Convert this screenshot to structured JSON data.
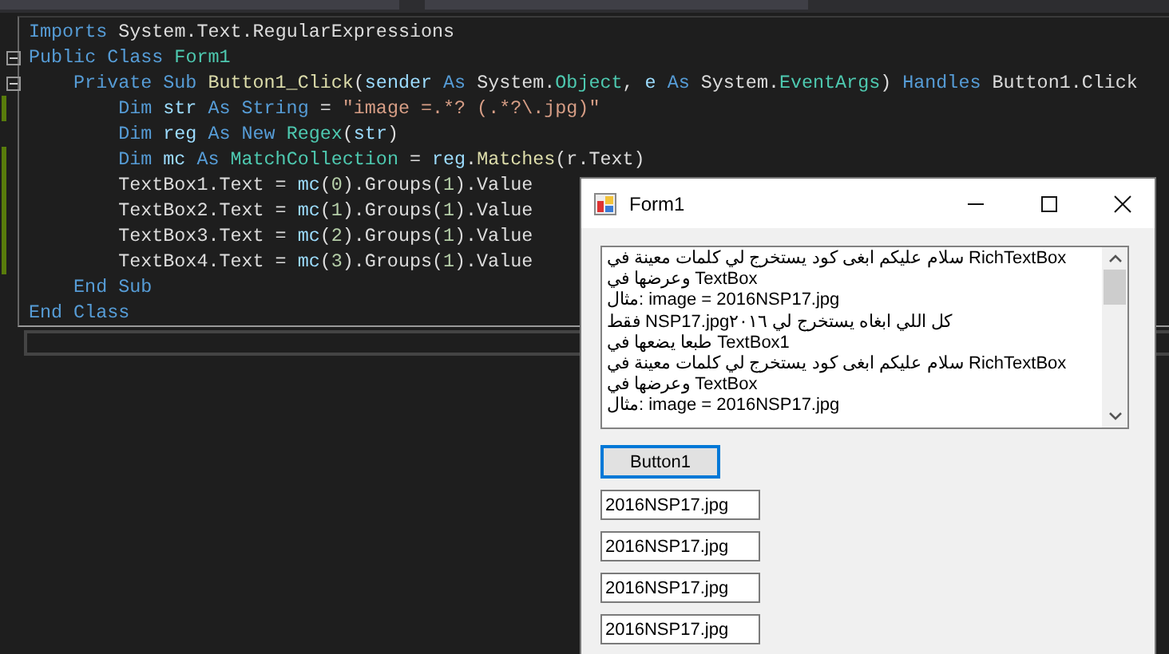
{
  "editor": {
    "lines": [
      {
        "tokens": [
          {
            "text": "Imports",
            "color": "#569cd6"
          },
          {
            "text": " System.Text.RegularExpressions",
            "color": "#dcdcdc"
          }
        ]
      },
      {
        "fold": true,
        "tokens": [
          {
            "text": "Public Class",
            "color": "#569cd6"
          },
          {
            "text": " Form1",
            "color": "#4ec9b0"
          }
        ],
        "children": [
          {
            "fold": true,
            "tokens": [
              {
                "text": "Private Sub",
                "color": "#569cd6"
              },
              {
                "text": " Button1_Click",
                "color": "#dcdcaa"
              },
              {
                "text": "(",
                "color": "#dcdcdc"
              },
              {
                "text": "sender",
                "color": "#9cdcfe"
              },
              {
                "text": " As",
                "color": "#569cd6"
              },
              {
                "text": " System.",
                "color": "#dcdcdc"
              },
              {
                "text": "Object",
                "color": "#4ec9b0"
              },
              {
                "text": ", ",
                "color": "#dcdcdc"
              },
              {
                "text": "e",
                "color": "#9cdcfe"
              },
              {
                "text": " As",
                "color": "#569cd6"
              },
              {
                "text": " System.",
                "color": "#dcdcdc"
              },
              {
                "text": "EventArgs",
                "color": "#4ec9b0"
              },
              {
                "text": ") ",
                "color": "#dcdcdc"
              },
              {
                "text": "Handles",
                "color": "#569cd6"
              },
              {
                "text": " Button1.Click",
                "color": "#dcdcdc"
              }
            ],
            "children": [
              {
                "changed": true,
                "tokens": [
                  {
                    "text": "Dim",
                    "color": "#569cd6"
                  },
                  {
                    "text": " str",
                    "color": "#9cdcfe"
                  },
                  {
                    "text": " As String",
                    "color": "#569cd6"
                  },
                  {
                    "text": " = ",
                    "color": "#dcdcdc"
                  },
                  {
                    "text": "\"image =.*? (.*?\\.jpg)\"",
                    "color": "#d69d85"
                  }
                ]
              },
              {
                "tokens": [
                  {
                    "text": "Dim",
                    "color": "#569cd6"
                  },
                  {
                    "text": " reg",
                    "color": "#9cdcfe"
                  },
                  {
                    "text": " As New",
                    "color": "#569cd6"
                  },
                  {
                    "text": " Regex",
                    "color": "#4ec9b0"
                  },
                  {
                    "text": "(",
                    "color": "#dcdcdc"
                  },
                  {
                    "text": "str",
                    "color": "#9cdcfe"
                  },
                  {
                    "text": ")",
                    "color": "#dcdcdc"
                  }
                ]
              },
              {
                "changed": true,
                "tokens": [
                  {
                    "text": "Dim",
                    "color": "#569cd6"
                  },
                  {
                    "text": " mc",
                    "color": "#9cdcfe"
                  },
                  {
                    "text": " As",
                    "color": "#569cd6"
                  },
                  {
                    "text": " MatchCollection",
                    "color": "#4ec9b0"
                  },
                  {
                    "text": " = ",
                    "color": "#dcdcdc"
                  },
                  {
                    "text": "reg",
                    "color": "#9cdcfe"
                  },
                  {
                    "text": ".",
                    "color": "#dcdcdc"
                  },
                  {
                    "text": "Matches",
                    "color": "#dcdcaa"
                  },
                  {
                    "text": "(r.Text)",
                    "color": "#dcdcdc"
                  }
                ]
              },
              {
                "changed": true,
                "tokens": [
                  {
                    "text": "TextBox1.Text = ",
                    "color": "#dcdcdc"
                  },
                  {
                    "text": "mc",
                    "color": "#9cdcfe"
                  },
                  {
                    "text": "(",
                    "color": "#dcdcdc"
                  },
                  {
                    "text": "0",
                    "color": "#b5cea8"
                  },
                  {
                    "text": ").Groups(",
                    "color": "#dcdcdc"
                  },
                  {
                    "text": "1",
                    "color": "#b5cea8"
                  },
                  {
                    "text": ").Value",
                    "color": "#dcdcdc"
                  }
                ]
              },
              {
                "changed": true,
                "tokens": [
                  {
                    "text": "TextBox2.Text = ",
                    "color": "#dcdcdc"
                  },
                  {
                    "text": "mc",
                    "color": "#9cdcfe"
                  },
                  {
                    "text": "(",
                    "color": "#dcdcdc"
                  },
                  {
                    "text": "1",
                    "color": "#b5cea8"
                  },
                  {
                    "text": ").Groups(",
                    "color": "#dcdcdc"
                  },
                  {
                    "text": "1",
                    "color": "#b5cea8"
                  },
                  {
                    "text": ").Value",
                    "color": "#dcdcdc"
                  }
                ]
              },
              {
                "changed": true,
                "tokens": [
                  {
                    "text": "TextBox3.Text = ",
                    "color": "#dcdcdc"
                  },
                  {
                    "text": "mc",
                    "color": "#9cdcfe"
                  },
                  {
                    "text": "(",
                    "color": "#dcdcdc"
                  },
                  {
                    "text": "2",
                    "color": "#b5cea8"
                  },
                  {
                    "text": ").Groups(",
                    "color": "#dcdcdc"
                  },
                  {
                    "text": "1",
                    "color": "#b5cea8"
                  },
                  {
                    "text": ").Value",
                    "color": "#dcdcdc"
                  }
                ]
              },
              {
                "changed": true,
                "tokens": [
                  {
                    "text": "TextBox4.Text = ",
                    "color": "#dcdcdc"
                  },
                  {
                    "text": "mc",
                    "color": "#9cdcfe"
                  },
                  {
                    "text": "(",
                    "color": "#dcdcdc"
                  },
                  {
                    "text": "3",
                    "color": "#b5cea8"
                  },
                  {
                    "text": ").Groups(",
                    "color": "#dcdcdc"
                  },
                  {
                    "text": "1",
                    "color": "#b5cea8"
                  },
                  {
                    "text": ").Value",
                    "color": "#dcdcdc"
                  }
                ]
              }
            ]
          },
          {
            "tokens": [
              {
                "text": "End Sub",
                "color": "#569cd6"
              }
            ]
          }
        ]
      },
      {
        "tokens": [
          {
            "text": "End Class",
            "color": "#569cd6"
          }
        ]
      }
    ]
  },
  "form": {
    "title": "Form1",
    "rich_text": [
      "سلام عليكم ابغى كود يستخرج لي كلمات معينة في  RichTextBox",
      "وعرضها في TextBox",
      "مثال: image = 2016NSP17.jpg",
      "فقط NSP17.jpgكل اللي ابغاه يستخرج لي ٢٠١٦",
      "طبعا يضعها في TextBox1",
      "سلام عليكم ابغى كود يستخرج لي كلمات معينة في  RichTextBox",
      "وعرضها في TextBox",
      "مثال: image = 2016NSP17.jpg"
    ],
    "button": {
      "label": "Button1",
      "focused": true
    },
    "textboxes": [
      "2016NSP17.jpg",
      "2016NSP17.jpg",
      "2016NSP17.jpg",
      "2016NSP17.jpg"
    ]
  }
}
